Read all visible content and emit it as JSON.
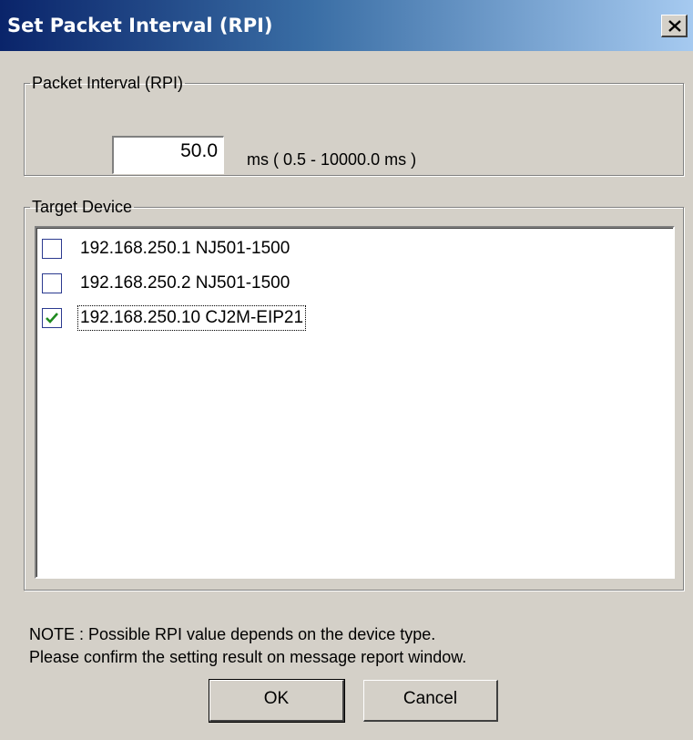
{
  "window": {
    "title": "Set Packet Interval (RPI)"
  },
  "rpi": {
    "group_label": "Packet Interval (RPI)",
    "value": "50.0",
    "range_text": "ms ( 0.5 - 10000.0 ms )"
  },
  "target": {
    "group_label": "Target Device",
    "devices": [
      {
        "label": "192.168.250.1 NJ501-1500",
        "checked": false
      },
      {
        "label": "192.168.250.2 NJ501-1500",
        "checked": false
      },
      {
        "label": "192.168.250.10 CJ2M-EIP21",
        "checked": true
      }
    ]
  },
  "note": {
    "line1": "NOTE : Possible RPI value depends on the device type.",
    "line2": "Please confirm the setting result on message report window."
  },
  "buttons": {
    "ok": "OK",
    "cancel": "Cancel"
  },
  "colors": {
    "title_start": "#0a246a",
    "title_end": "#a6caf0",
    "face": "#d4d0c8",
    "check": "#1f8a1f"
  }
}
